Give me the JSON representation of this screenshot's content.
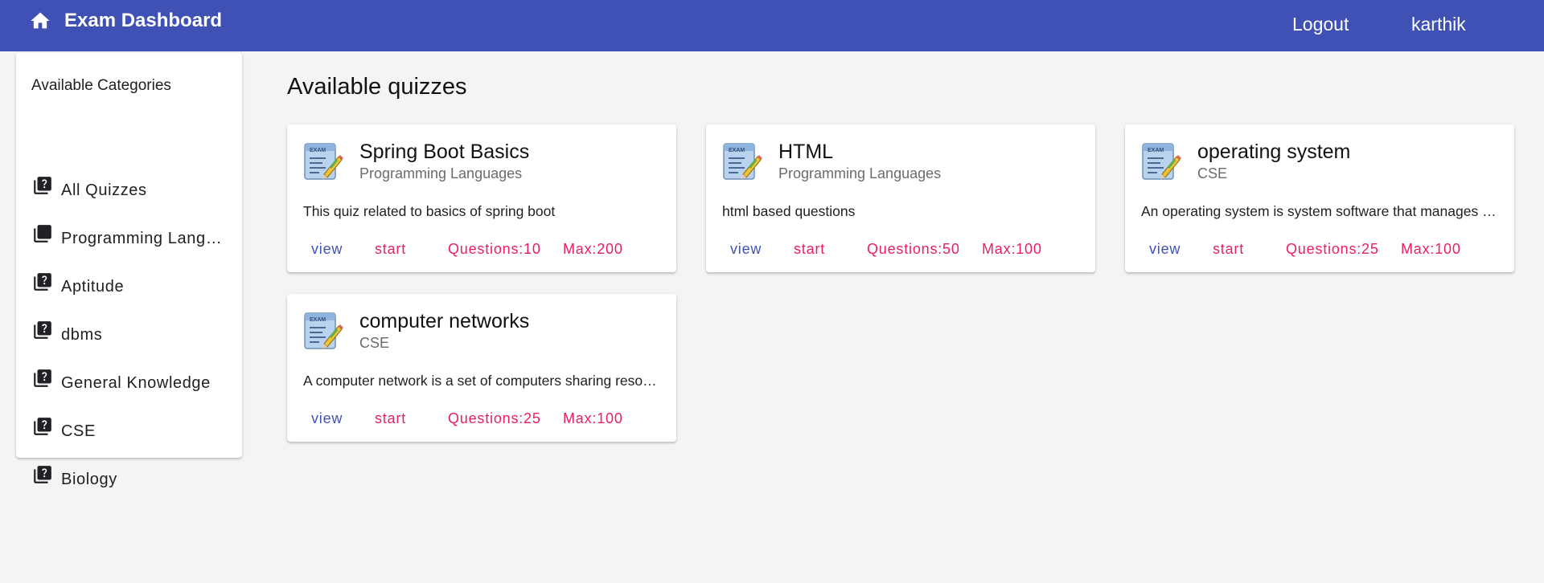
{
  "header": {
    "brand": "Exam Dashboard",
    "logout_label": "Logout",
    "username": "karthik",
    "bg_color": "#3f51b5"
  },
  "sidebar": {
    "title": "Available Categories",
    "items": [
      {
        "label": "All Quizzes",
        "icon": "quiz-icon"
      },
      {
        "label": "Programming Languages",
        "icon": "quiz-icon"
      },
      {
        "label": "Aptitude",
        "icon": "quiz-icon"
      },
      {
        "label": "dbms",
        "icon": "quiz-icon"
      },
      {
        "label": "General Knowledge",
        "icon": "quiz-icon"
      },
      {
        "label": "CSE",
        "icon": "quiz-icon"
      },
      {
        "label": "Biology",
        "icon": "quiz-icon"
      }
    ]
  },
  "main": {
    "title": "Available quizzes",
    "quizzes": [
      {
        "title": "Spring Boot Basics",
        "category": "Programming Languages",
        "description": "This quiz related to basics of spring boot",
        "view_label": "view",
        "start_label": "start",
        "questions_label": "Questions:10",
        "max_label": "Max:200",
        "icon": "exam-icon"
      },
      {
        "title": "HTML",
        "category": "Programming Languages",
        "description": "html based questions",
        "view_label": "view",
        "start_label": "start",
        "questions_label": "Questions:50",
        "max_label": "Max:100",
        "icon": "exam-icon"
      },
      {
        "title": "operating system",
        "category": "CSE",
        "description": "An operating system is system software that manages computer hardware and software resources",
        "view_label": "view",
        "start_label": "start",
        "questions_label": "Questions:25",
        "max_label": "Max:100",
        "icon": "exam-icon"
      },
      {
        "title": "computer networks",
        "category": "CSE",
        "description": "A computer network is a set of computers sharing resources located on or provided by network nodes",
        "view_label": "view",
        "start_label": "start",
        "questions_label": "Questions:25",
        "max_label": "Max:100",
        "icon": "exam-icon"
      }
    ]
  },
  "colors": {
    "primary": "#3f51b5",
    "accent": "#e91e63",
    "background": "#f4f4f4"
  }
}
